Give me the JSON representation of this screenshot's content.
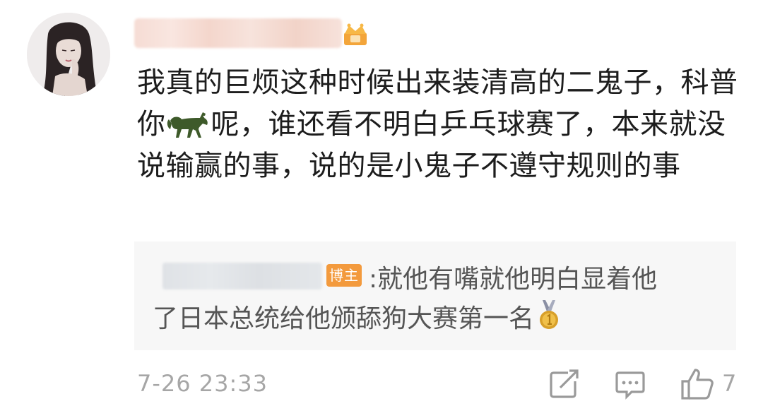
{
  "comment": {
    "text": "我真的巨烦这种时候出来装清高的二鬼子，科普你🐎呢，谁还看不明白乒乓球赛了，本来就没说输赢的事，说的是小鬼子不遵守规则的事",
    "text_before_emoji": "我真的巨烦这种时候出来装清高的二鬼子，科普你",
    "text_after_emoji": "呢，谁还看不明白乒乓球赛了，本来就没说输赢的事，说的是小鬼子不遵守规则的事",
    "timestamp": "7-26 23:33"
  },
  "reply": {
    "badge": "博主",
    "line1": ":就他有嘴就他明白显着他",
    "line2": "了日本总统给他颁舔狗大赛第一名"
  },
  "actions": {
    "like_count": "7"
  },
  "icons": {
    "crown": "crown-icon",
    "horse": "horse-icon",
    "medal": "gold-medal-icon",
    "share": "share-icon",
    "reply": "comment-icon",
    "like": "thumbs-up-icon"
  },
  "colors": {
    "text": "#1d1d1d",
    "reply_text": "#555555",
    "meta": "#a6a6a6",
    "reply_bg": "#f7f7f7",
    "badge": "#f39a3d"
  }
}
